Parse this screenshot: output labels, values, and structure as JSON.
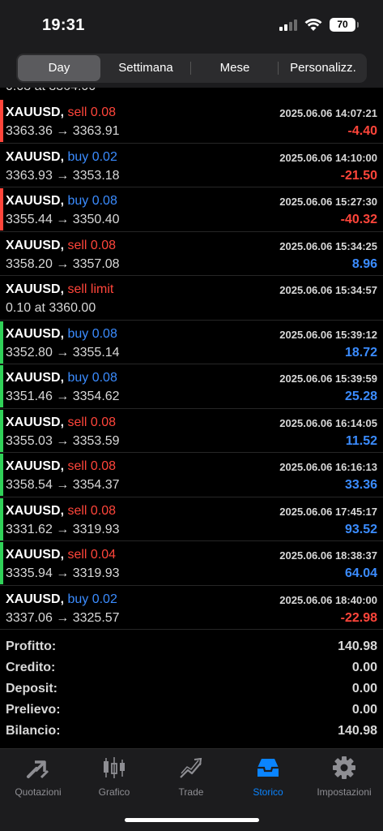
{
  "status": {
    "time": "19:31",
    "battery": "70"
  },
  "segments": [
    "Day",
    "Settimana",
    "Mese",
    "Personalizz."
  ],
  "active_segment": "Day",
  "partial_row_text": "0.03 at 3364.00",
  "trades": [
    {
      "symbol": "XAUUSD,",
      "side": "sell 0.08",
      "type": "sell",
      "date": "2025.06.06 14:07:21",
      "price": "3363.36 → 3363.91",
      "profit": "-4.40",
      "profit_color": "#ff453a",
      "bar_color": "#ff453a"
    },
    {
      "symbol": "XAUUSD,",
      "side": "buy 0.02",
      "type": "buy",
      "date": "2025.06.06 14:10:00",
      "price": "3363.93 → 3353.18",
      "profit": "-21.50",
      "profit_color": "#ff453a",
      "bar_color": ""
    },
    {
      "symbol": "XAUUSD,",
      "side": "buy 0.08",
      "type": "buy",
      "date": "2025.06.06 15:27:30",
      "price": "3355.44 → 3350.40",
      "profit": "-40.32",
      "profit_color": "#ff453a",
      "bar_color": "#ff453a"
    },
    {
      "symbol": "XAUUSD,",
      "side": "sell 0.08",
      "type": "sell",
      "date": "2025.06.06 15:34:25",
      "price": "3358.20 → 3357.08",
      "profit": "8.96",
      "profit_color": "#3b8cff",
      "bar_color": ""
    },
    {
      "symbol": "XAUUSD,",
      "side": "sell limit",
      "type": "sell",
      "date": "2025.06.06 15:34:57",
      "price": "0.10 at 3360.00",
      "profit": "",
      "profit_color": "#3b8cff",
      "bar_color": ""
    },
    {
      "symbol": "XAUUSD,",
      "side": "buy 0.08",
      "type": "buy",
      "date": "2025.06.06 15:39:12",
      "price": "3352.80 → 3355.14",
      "profit": "18.72",
      "profit_color": "#3b8cff",
      "bar_color": "#30d158"
    },
    {
      "symbol": "XAUUSD,",
      "side": "buy 0.08",
      "type": "buy",
      "date": "2025.06.06 15:39:59",
      "price": "3351.46 → 3354.62",
      "profit": "25.28",
      "profit_color": "#3b8cff",
      "bar_color": "#30d158"
    },
    {
      "symbol": "XAUUSD,",
      "side": "sell 0.08",
      "type": "sell",
      "date": "2025.06.06 16:14:05",
      "price": "3355.03 → 3353.59",
      "profit": "11.52",
      "profit_color": "#3b8cff",
      "bar_color": "#30d158"
    },
    {
      "symbol": "XAUUSD,",
      "side": "sell 0.08",
      "type": "sell",
      "date": "2025.06.06 16:16:13",
      "price": "3358.54 → 3354.37",
      "profit": "33.36",
      "profit_color": "#3b8cff",
      "bar_color": "#30d158"
    },
    {
      "symbol": "XAUUSD,",
      "side": "sell 0.08",
      "type": "sell",
      "date": "2025.06.06 17:45:17",
      "price": "3331.62 → 3319.93",
      "profit": "93.52",
      "profit_color": "#3b8cff",
      "bar_color": "#30d158"
    },
    {
      "symbol": "XAUUSD,",
      "side": "sell 0.04",
      "type": "sell",
      "date": "2025.06.06 18:38:37",
      "price": "3335.94 → 3319.93",
      "profit": "64.04",
      "profit_color": "#3b8cff",
      "bar_color": "#30d158"
    },
    {
      "symbol": "XAUUSD,",
      "side": "buy 0.02",
      "type": "buy",
      "date": "2025.06.06 18:40:00",
      "price": "3337.06 → 3325.57",
      "profit": "-22.98",
      "profit_color": "#ff453a",
      "bar_color": ""
    }
  ],
  "summary": [
    {
      "label": "Profitto:",
      "value": "140.98"
    },
    {
      "label": "Credito:",
      "value": "0.00"
    },
    {
      "label": "Deposit:",
      "value": "0.00"
    },
    {
      "label": "Prelievo:",
      "value": "0.00"
    },
    {
      "label": "Bilancio:",
      "value": "140.98"
    }
  ],
  "tabs": [
    {
      "label": "Quotazioni",
      "icon": "quotes-icon"
    },
    {
      "label": "Grafico",
      "icon": "chart-icon"
    },
    {
      "label": "Trade",
      "icon": "trade-icon"
    },
    {
      "label": "Storico",
      "icon": "history-icon"
    },
    {
      "label": "Impostazioni",
      "icon": "settings-icon"
    }
  ],
  "colors": {
    "sell": "#ff453a",
    "buy": "#3b8cff",
    "accent": "#0a84ff",
    "profit_bar": "#30d158"
  }
}
